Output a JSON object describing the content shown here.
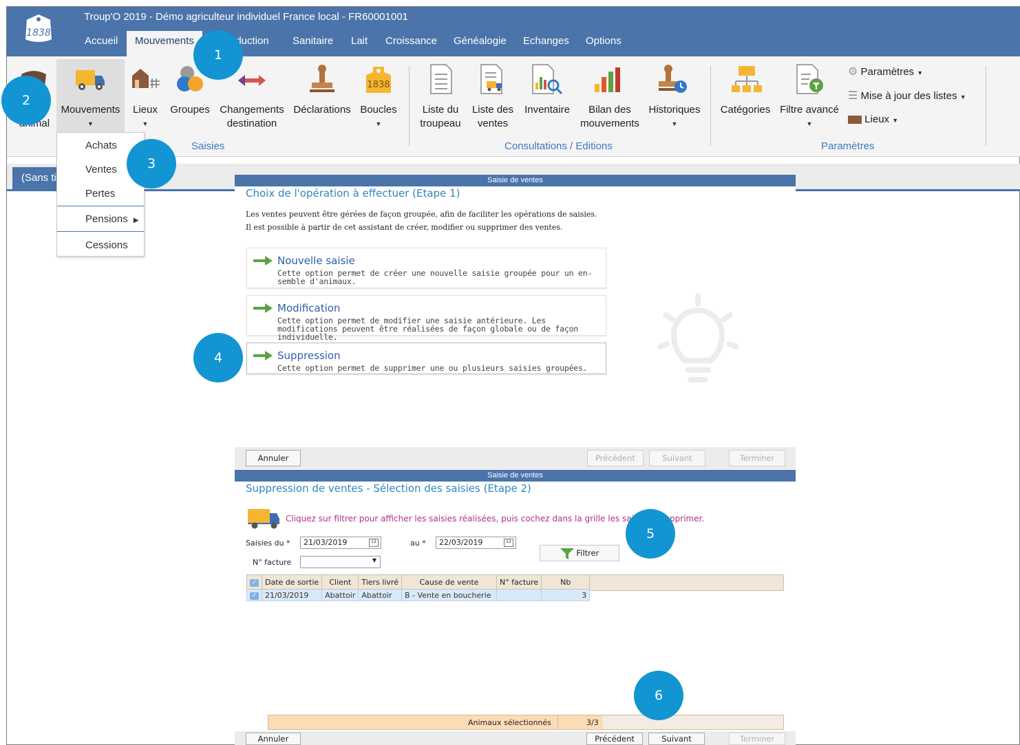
{
  "window": {
    "title": "Troup'O 2019 - Démo agriculteur individuel France local - FR60001001",
    "logo_text": "1838"
  },
  "menu": [
    "Accueil",
    "Mouvements",
    "Production",
    "Sanitaire",
    "Lait",
    "Croissance",
    "Généalogie",
    "Echanges",
    "Options"
  ],
  "ribbon": {
    "animal": "animal",
    "mouvements": "Mouvements",
    "lieux": "Lieux",
    "groupes": "Groupes",
    "changements_1": "Changements",
    "changements_2": "destination",
    "declarations": "Déclarations",
    "boucles": "Boucles",
    "boucle_icon_text": "1838",
    "liste_troupeau_1": "Liste du",
    "liste_troupeau_2": "troupeau",
    "liste_ventes_1": "Liste des",
    "liste_ventes_2": "ventes",
    "inventaire": "Inventaire",
    "bilan_1": "Bilan des",
    "bilan_2": "mouvements",
    "historiques": "Historiques",
    "categories": "Catégories",
    "filtre_avance": "Filtre avancé",
    "parametres_menu": "Paramètres",
    "maj_listes": "Mise à jour des listes",
    "lieux_menu": "Lieux",
    "group_saisies": "Saisies",
    "group_consultations": "Consultations / Editions",
    "group_parametres": "Paramètres"
  },
  "doc_tab": "(Sans titre)",
  "dropdown": [
    "Achats",
    "Ventes",
    "Pertes",
    "Pensions",
    "Cessions"
  ],
  "wizard1": {
    "header": "Saisie de ventes",
    "title": "Choix de l'opération à effectuer (Etape 1)",
    "intro_1": "Les ventes peuvent être gérées de façon groupée, afin de faciliter les opérations de saisies.",
    "intro_2": "Il est possible à partir de cet assistant de créer, modifier ou supprimer des ventes.",
    "options": [
      {
        "title": "Nouvelle saisie",
        "desc": "Cette option permet de créer une nouvelle saisie groupée pour un en-semble d'animaux."
      },
      {
        "title": "Modification",
        "desc": "Cette option permet de modifier une saisie antérieure. Les modifications peuvent être réalisées de façon globale ou de façon individuelle."
      },
      {
        "title": "Suppression",
        "desc": "Cette option permet de supprimer une ou plusieurs saisies groupées."
      }
    ],
    "btn_annuler": "Annuler",
    "btn_precedent": "Précédent",
    "btn_suivant": "Suivant",
    "btn_terminer": "Terminer"
  },
  "wizard2": {
    "header": "Saisie de ventes",
    "title": "Suppression de ventes - Sélection des saisies (Etape 2)",
    "instruction": "Cliquez sur filtrer pour afficher les saisies réalisées, puis cochez dans la grille les saisies à supprimer.",
    "label_from": "Saisies du *",
    "date_from": "21/03/2019",
    "label_to": "au *",
    "date_to": "22/03/2019",
    "label_facture": "N° facture",
    "facture_value": "",
    "btn_filtrer": "Filtrer",
    "columns": [
      "Date de sortie",
      "Client",
      "Tiers livré",
      "Cause de vente",
      "N° facture",
      "Nb"
    ],
    "rows": [
      {
        "date": "21/03/2019",
        "client": "Abattoir",
        "tiers": "Abattoir",
        "cause": "B - Vente en boucherie",
        "facture": "",
        "nb": "3"
      }
    ],
    "selected_label": "Animaux sélectionnés",
    "selected_value": "3/3",
    "btn_annuler": "Annuler",
    "btn_precedent": "Précédent",
    "btn_suivant": "Suivant",
    "btn_terminer": "Terminer"
  },
  "callouts": [
    "1",
    "2",
    "3",
    "4",
    "5",
    "6"
  ],
  "colors": {
    "titlebar": "#4a74aa",
    "accent": "#1295d2",
    "link": "#2b5fa8",
    "instruction": "#b0308a"
  }
}
